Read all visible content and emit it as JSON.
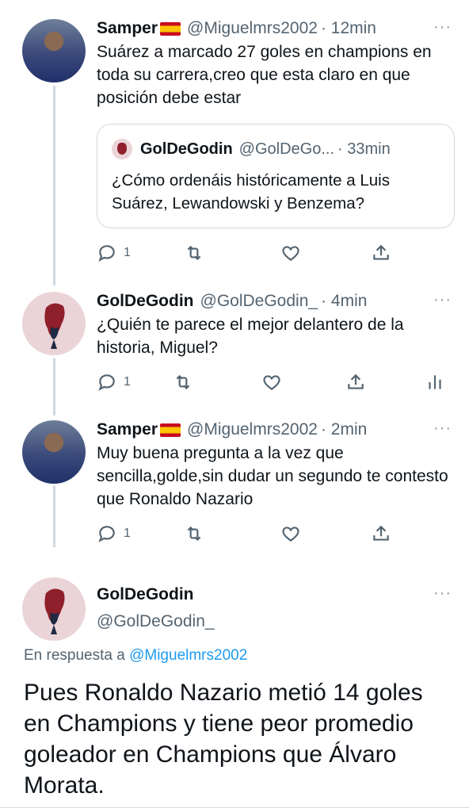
{
  "tweets": [
    {
      "name": "Samper",
      "handle": "@Miguelmrs2002",
      "time": "· 12min",
      "text": "Suárez a marcado 27 goles en champions en toda su carrera,creo que esta claro en que posición debe estar",
      "reply_count": "1",
      "quote": {
        "name": "GolDeGodin",
        "handle": "@GolDeGo...",
        "time": "· 33min",
        "text": "¿Cómo ordenáis históricamente a Luis Suárez, Lewandowski y Benzema?"
      }
    },
    {
      "name": "GolDeGodin",
      "handle": "@GolDeGodin_",
      "time": "· 4min",
      "text": "¿Quién te parece el mejor delantero de la historia, Miguel?",
      "reply_count": "1"
    },
    {
      "name": "Samper",
      "handle": "@Miguelmrs2002",
      "time": "· 2min",
      "text": "Muy buena pregunta a la vez que sencilla,golde,sin dudar un segundo te contesto que Ronaldo Nazario",
      "reply_count": "1"
    }
  ],
  "main": {
    "name": "GolDeGodin",
    "handle": "@GolDeGodin_",
    "reply_prefix": "En respuesta a ",
    "reply_mention": "@Miguelmrs2002",
    "text": "Pues Ronaldo Nazario metió 14 goles en Champions y tiene peor promedio goleador en Champions que Álvaro Morata."
  },
  "icons": {
    "more": "more-options-icon",
    "reply": "reply-icon",
    "retweet": "retweet-icon",
    "like": "like-icon",
    "share": "share-icon",
    "analytics": "analytics-icon",
    "flag": "spain-flag-icon"
  },
  "colors": {
    "text": "#0f1419",
    "secondary": "#536471",
    "link": "#1d9bf0",
    "border": "#cfd9de"
  },
  "more_glyph": "···"
}
